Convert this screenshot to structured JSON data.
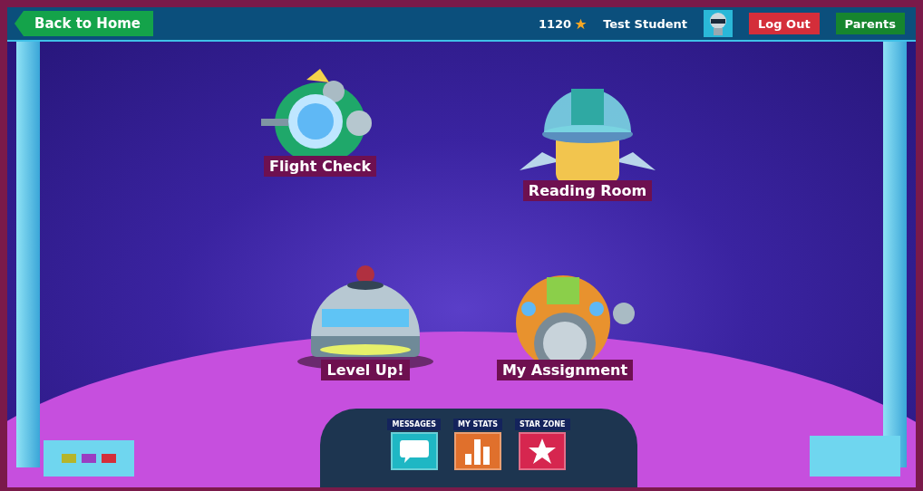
{
  "top_bar": {
    "back_button": "Back to Home",
    "points": "1120",
    "student_name": "Test Student",
    "logout_button": "Log Out",
    "parents_button": "Parents"
  },
  "destinations": [
    {
      "label": "Flight Check",
      "kind": "ship"
    },
    {
      "label": "Reading Room",
      "kind": "rocket"
    },
    {
      "label": "Level Up!",
      "kind": "dome"
    },
    {
      "label": "My Assignment",
      "kind": "sphere"
    }
  ],
  "console": {
    "buttons": [
      {
        "label": "MESSAGES",
        "kind": "messages"
      },
      {
        "label": "MY STATS",
        "kind": "stats"
      },
      {
        "label": "STAR ZONE",
        "kind": "star"
      }
    ]
  }
}
